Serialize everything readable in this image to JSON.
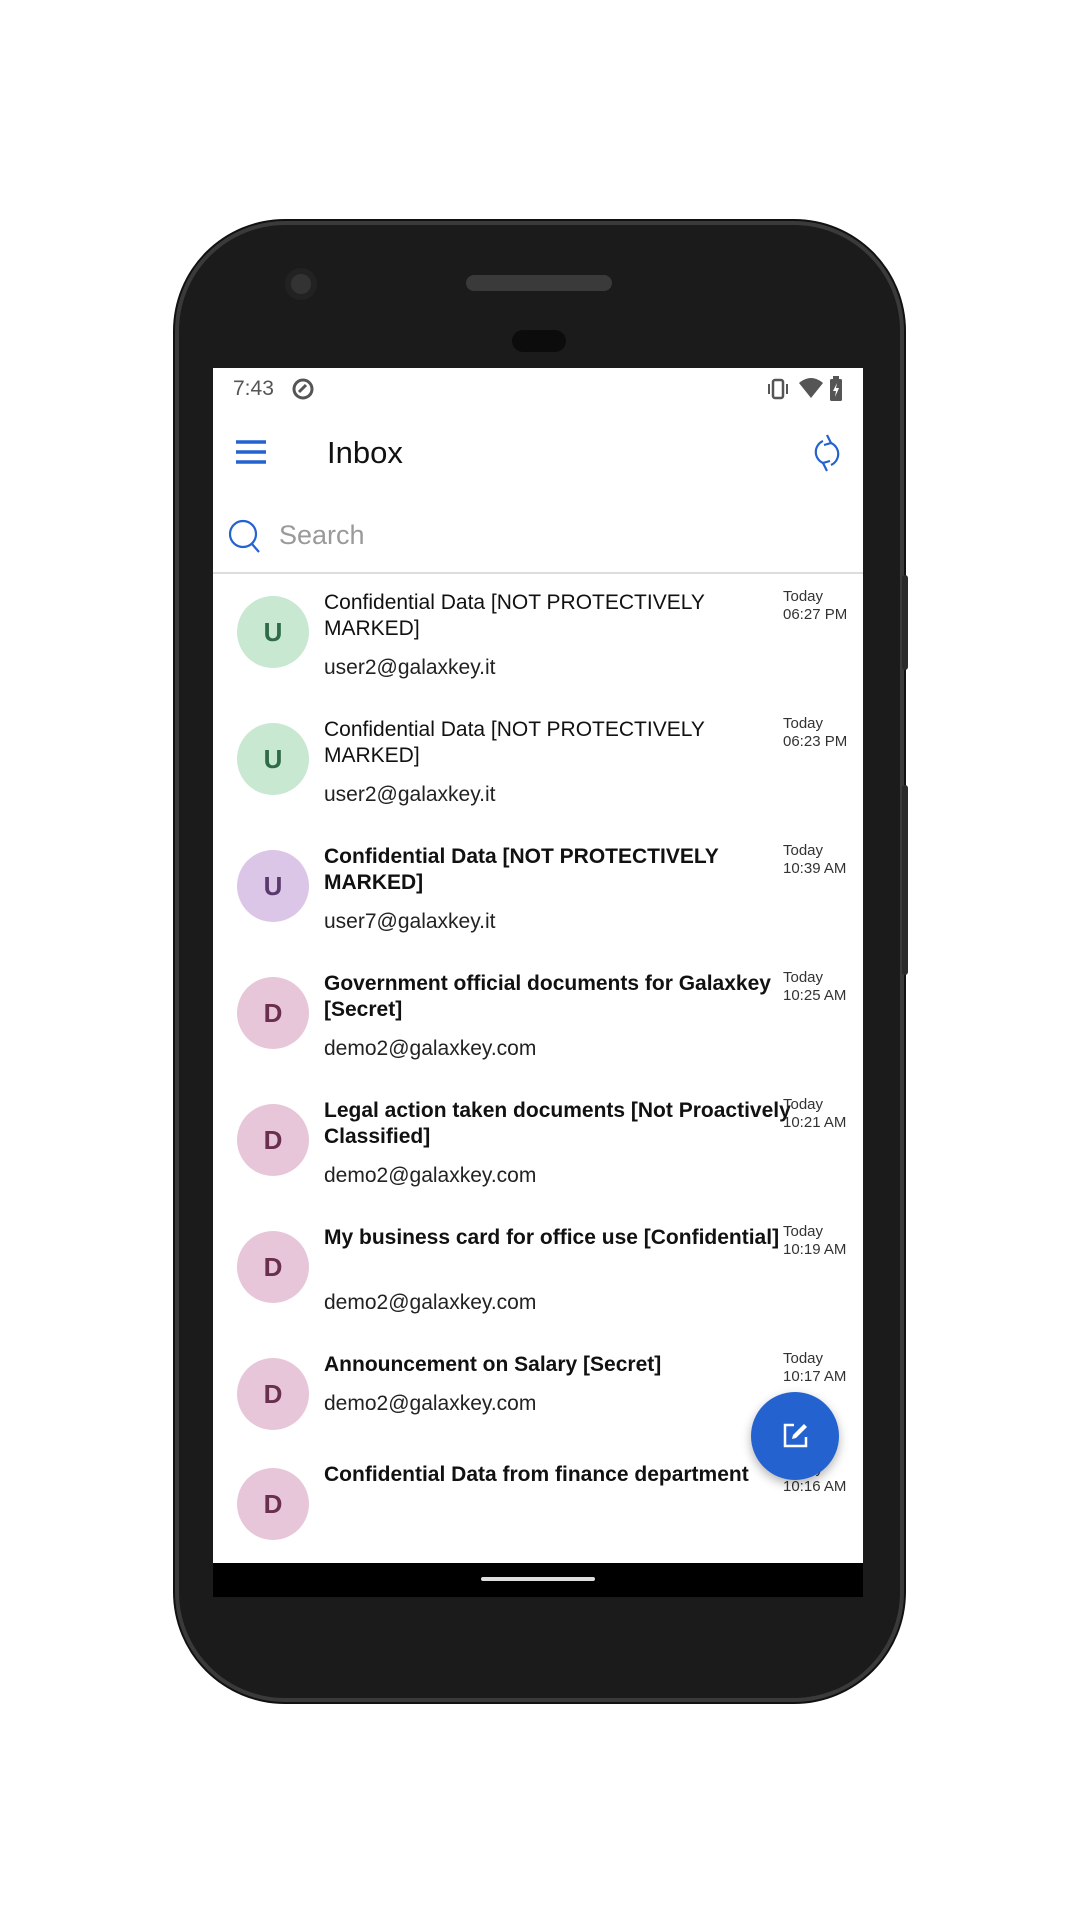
{
  "status_bar": {
    "time": "7:43"
  },
  "toolbar": {
    "title": "Inbox",
    "menu_icon": "hamburger-icon",
    "refresh_icon": "sync-icon"
  },
  "search": {
    "placeholder": "Search",
    "value": ""
  },
  "colors": {
    "accent": "#2462d0"
  },
  "emails": [
    {
      "initial": "U",
      "subject": "Confidential Data [NOT PROTECTIVELY MARKED]",
      "from": "user2@galaxkey.it",
      "day": "Today",
      "time": "06:27 PM",
      "unread": false,
      "bg": "#c8e8d2",
      "fg": "#2f6b46"
    },
    {
      "initial": "U",
      "subject": "Confidential Data [NOT PROTECTIVELY MARKED]",
      "from": "user2@galaxkey.it",
      "day": "Today",
      "time": "06:23 PM",
      "unread": false,
      "bg": "#c8e8d2",
      "fg": "#2f6b46"
    },
    {
      "initial": "U",
      "subject": "Confidential Data [NOT PROTECTIVELY MARKED]",
      "from": "user7@galaxkey.it",
      "day": "Today",
      "time": "10:39 AM",
      "unread": true,
      "bg": "#dcc6e8",
      "fg": "#5a3a6e"
    },
    {
      "initial": "D",
      "subject": "Government official documents for Galaxkey [Secret]",
      "from": "demo2@galaxkey.com",
      "day": "Today",
      "time": "10:25 AM",
      "unread": true,
      "bg": "#e8c6da",
      "fg": "#6a2f4e"
    },
    {
      "initial": "D",
      "subject": "Legal action taken documents [Not Proactively Classified]",
      "from": "demo2@galaxkey.com",
      "day": "Today",
      "time": "10:21 AM",
      "unread": true,
      "bg": "#e8c6da",
      "fg": "#6a2f4e"
    },
    {
      "initial": "D",
      "subject": "My business card for office use [Confidential]",
      "from": "demo2@galaxkey.com",
      "day": "Today",
      "time": "10:19 AM",
      "unread": true,
      "bg": "#e8c6da",
      "fg": "#6a2f4e"
    },
    {
      "initial": "D",
      "subject": "Announcement on Salary [Secret]",
      "from": "demo2@galaxkey.com",
      "day": "Today",
      "time": "10:17 AM",
      "unread": true,
      "bg": "#e8c6da",
      "fg": "#6a2f4e"
    },
    {
      "initial": "D",
      "subject": "Confidential Data from finance department",
      "from": "",
      "day": "Today",
      "time": "10:16 AM",
      "unread": true,
      "bg": "#e8c6da",
      "fg": "#6a2f4e"
    }
  ],
  "fab": {
    "icon": "compose-icon"
  }
}
